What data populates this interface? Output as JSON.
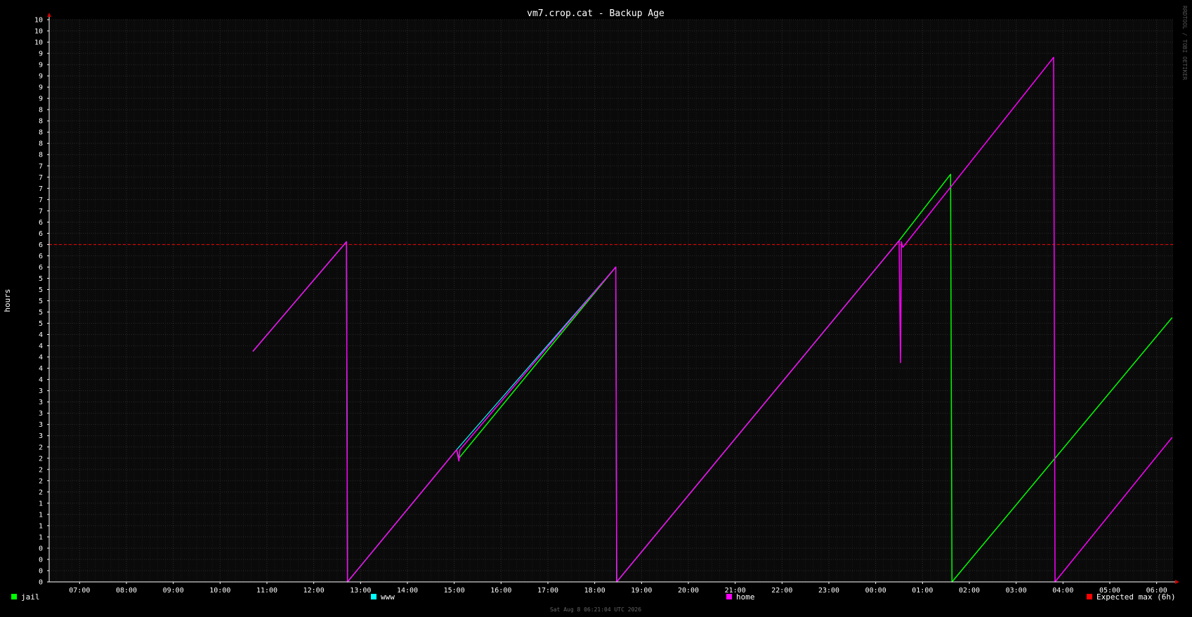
{
  "colors": {
    "background": "#000000",
    "plot_background": "#0a0a0a",
    "grid_minor": "#1a1a1a",
    "grid_major": "#2b2b2b",
    "text": "#ffffff",
    "axis_arrow": "#cc0000",
    "watermark": "#555555"
  },
  "chart_data": {
    "type": "line",
    "title": "vm7.crop.cat - Backup Age",
    "ylabel": "hours",
    "xlabel": "",
    "watermark": "RRDTOOL / TOBI OETIKER",
    "footer": "Sat Aug  8 06:21:04 UTC 2026",
    "x_unit": "hours since 06:21 (time of day on axis)",
    "xlim": [
      6.35,
      30.35
    ],
    "ylim": [
      0,
      10
    ],
    "grid": true,
    "legend_position": "bottom",
    "x_ticks": [
      {
        "x": 7,
        "label": "07:00"
      },
      {
        "x": 8,
        "label": "08:00"
      },
      {
        "x": 9,
        "label": "09:00"
      },
      {
        "x": 10,
        "label": "10:00"
      },
      {
        "x": 11,
        "label": "11:00"
      },
      {
        "x": 12,
        "label": "12:00"
      },
      {
        "x": 13,
        "label": "13:00"
      },
      {
        "x": 14,
        "label": "14:00"
      },
      {
        "x": 15,
        "label": "15:00"
      },
      {
        "x": 16,
        "label": "16:00"
      },
      {
        "x": 17,
        "label": "17:00"
      },
      {
        "x": 18,
        "label": "18:00"
      },
      {
        "x": 19,
        "label": "19:00"
      },
      {
        "x": 20,
        "label": "20:00"
      },
      {
        "x": 21,
        "label": "21:00"
      },
      {
        "x": 22,
        "label": "22:00"
      },
      {
        "x": 23,
        "label": "23:00"
      },
      {
        "x": 24,
        "label": "00:00"
      },
      {
        "x": 25,
        "label": "01:00"
      },
      {
        "x": 26,
        "label": "02:00"
      },
      {
        "x": 27,
        "label": "03:00"
      },
      {
        "x": 28,
        "label": "04:00"
      },
      {
        "x": 29,
        "label": "05:00"
      },
      {
        "x": 30,
        "label": "06:00"
      }
    ],
    "y_ticks": [
      {
        "y": 0,
        "label": "0"
      },
      {
        "y": 0.2,
        "label": "0"
      },
      {
        "y": 0.4,
        "label": "0"
      },
      {
        "y": 0.6,
        "label": "0"
      },
      {
        "y": 0.8,
        "label": "1"
      },
      {
        "y": 1.0,
        "label": "1"
      },
      {
        "y": 1.2,
        "label": "1"
      },
      {
        "y": 1.4,
        "label": "1"
      },
      {
        "y": 1.6,
        "label": "2"
      },
      {
        "y": 1.8,
        "label": "2"
      },
      {
        "y": 2.0,
        "label": "2"
      },
      {
        "y": 2.2,
        "label": "2"
      },
      {
        "y": 2.4,
        "label": "2"
      },
      {
        "y": 2.6,
        "label": "3"
      },
      {
        "y": 2.8,
        "label": "3"
      },
      {
        "y": 3.0,
        "label": "3"
      },
      {
        "y": 3.2,
        "label": "3"
      },
      {
        "y": 3.4,
        "label": "3"
      },
      {
        "y": 3.6,
        "label": "4"
      },
      {
        "y": 3.8,
        "label": "4"
      },
      {
        "y": 4.0,
        "label": "4"
      },
      {
        "y": 4.2,
        "label": "4"
      },
      {
        "y": 4.4,
        "label": "4"
      },
      {
        "y": 4.6,
        "label": "5"
      },
      {
        "y": 4.8,
        "label": "5"
      },
      {
        "y": 5.0,
        "label": "5"
      },
      {
        "y": 5.2,
        "label": "5"
      },
      {
        "y": 5.4,
        "label": "5"
      },
      {
        "y": 5.6,
        "label": "6"
      },
      {
        "y": 5.8,
        "label": "6"
      },
      {
        "y": 6.0,
        "label": "6"
      },
      {
        "y": 6.2,
        "label": "6"
      },
      {
        "y": 6.4,
        "label": "6"
      },
      {
        "y": 6.6,
        "label": "7"
      },
      {
        "y": 6.8,
        "label": "7"
      },
      {
        "y": 7.0,
        "label": "7"
      },
      {
        "y": 7.2,
        "label": "7"
      },
      {
        "y": 7.4,
        "label": "7"
      },
      {
        "y": 7.6,
        "label": "8"
      },
      {
        "y": 7.8,
        "label": "8"
      },
      {
        "y": 8.0,
        "label": "8"
      },
      {
        "y": 8.2,
        "label": "8"
      },
      {
        "y": 8.4,
        "label": "8"
      },
      {
        "y": 8.6,
        "label": "9"
      },
      {
        "y": 8.8,
        "label": "9"
      },
      {
        "y": 9.0,
        "label": "9"
      },
      {
        "y": 9.2,
        "label": "9"
      },
      {
        "y": 9.4,
        "label": "9"
      },
      {
        "y": 9.6,
        "label": "10"
      },
      {
        "y": 9.8,
        "label": "10"
      },
      {
        "y": 10.0,
        "label": "10"
      }
    ],
    "legend": [
      {
        "name": "jail",
        "color": "#00ff00"
      },
      {
        "name": "www",
        "color": "#00ffff"
      },
      {
        "name": "home",
        "color": "#ff00ff"
      },
      {
        "name": "Expected max (6h)",
        "color": "#ff0000"
      }
    ],
    "hlines": [
      {
        "name": "Expected max (6h)",
        "y": 6.0,
        "color": "#ff0000",
        "dashed": true
      }
    ],
    "series": [
      {
        "name": "jail",
        "color": "#00ff00",
        "width": 1.5,
        "points": [
          [
            10.7,
            4.1
          ],
          [
            12.7,
            6.05
          ],
          [
            12.72,
            0.0
          ],
          [
            15.05,
            2.35
          ],
          [
            15.1,
            2.2
          ],
          [
            18.45,
            5.6
          ],
          [
            18.47,
            0.0
          ],
          [
            24.5,
            6.07
          ],
          [
            25.6,
            7.25
          ],
          [
            25.63,
            0.0
          ],
          [
            30.33,
            4.7
          ]
        ]
      },
      {
        "name": "www",
        "color": "#00ffff",
        "width": 1.2,
        "points": [
          [
            10.7,
            4.1
          ],
          [
            12.7,
            6.05
          ],
          [
            12.72,
            0.0
          ],
          [
            15.05,
            2.35
          ],
          [
            18.45,
            5.6
          ],
          [
            18.47,
            0.0
          ],
          [
            24.5,
            6.07
          ]
        ]
      },
      {
        "name": "home",
        "color": "#ff00ff",
        "width": 1.5,
        "points": [
          [
            10.7,
            4.1
          ],
          [
            12.7,
            6.05
          ],
          [
            12.72,
            0.0
          ],
          [
            15.05,
            2.35
          ],
          [
            15.1,
            2.15
          ],
          [
            15.12,
            2.35
          ],
          [
            18.45,
            5.6
          ],
          [
            18.47,
            0.0
          ],
          [
            24.5,
            6.07
          ],
          [
            24.53,
            3.9
          ],
          [
            24.55,
            6.05
          ],
          [
            24.58,
            5.95
          ],
          [
            27.8,
            9.33
          ],
          [
            27.83,
            0.0
          ],
          [
            30.33,
            2.57
          ]
        ]
      }
    ]
  }
}
